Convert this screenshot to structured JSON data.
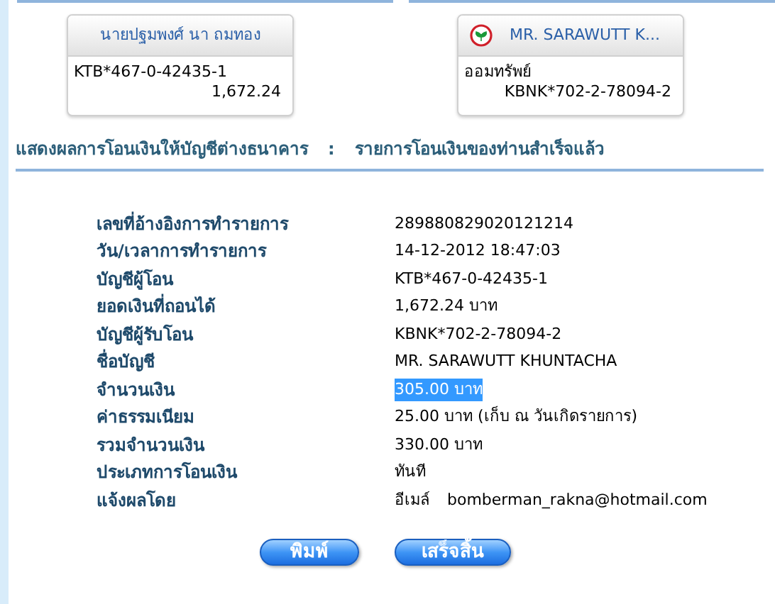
{
  "from_card": {
    "name": "นายปฐมพงศ์ นา ถมทอง",
    "account": "KTB*467-0-42435-1",
    "amount": "1,672.24"
  },
  "to_card": {
    "name": "MR. SARAWUTT K...",
    "account_type": "ออมทรัพย์",
    "account": "KBNK*702-2-78094-2"
  },
  "heading": {
    "title": "แสดงผลการโอนเงินให้บัญชีต่างธนาคาร",
    "separator": ":",
    "status": "รายการโอนเงินของท่านสำเร็จแล้ว"
  },
  "rows": [
    {
      "label": "เลขที่อ้างอิงการทำรายการ",
      "value": "289880829020121214",
      "highlighted": false
    },
    {
      "label": "วัน/เวลาการทำรายการ",
      "value": "14-12-2012 18:47:03",
      "highlighted": false
    },
    {
      "label": "บัญชีผู้โอน",
      "value": "KTB*467-0-42435-1",
      "highlighted": false
    },
    {
      "label": "ยอดเงินที่ถอนได้",
      "value": "1,672.24 บาท",
      "highlighted": false
    },
    {
      "label": "บัญชีผู้รับโอน",
      "value": "KBNK*702-2-78094-2",
      "highlighted": false
    },
    {
      "label": "ชื่อบัญชี",
      "value": "MR. SARAWUTT KHUNTACHA",
      "highlighted": false
    },
    {
      "label": "จำนวนเงิน",
      "value": "305.00 บาท",
      "highlighted": true
    },
    {
      "label": "ค่าธรรมเนียม",
      "value": "25.00 บาท (เก็บ ณ วันเกิดรายการ)",
      "highlighted": false
    },
    {
      "label": "รวมจำนวนเงิน",
      "value": "330.00 บาท",
      "highlighted": false
    },
    {
      "label": "ประเภทการโอนเงิน",
      "value": "ทันที",
      "highlighted": false
    },
    {
      "label": "แจ้งผลโดย",
      "method": "อีเมล์",
      "value": "bomberman_rakna@hotmail.com",
      "highlighted": false
    }
  ],
  "buttons": [
    "พิมพ์",
    "เสร็จสิ้น"
  ]
}
